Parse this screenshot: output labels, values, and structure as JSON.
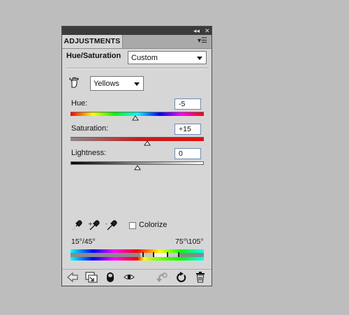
{
  "panel": {
    "tab_label": "ADJUSTMENTS",
    "window_controls": "◂◂ ✕",
    "adjustment_title": "Hue/Saturation",
    "preset": {
      "selected": "Custom"
    },
    "channel": {
      "selected": "Yellows"
    }
  },
  "sliders": {
    "hue": {
      "label": "Hue:",
      "value": "-5",
      "value_num": -5,
      "min": -180,
      "max": 180
    },
    "saturation": {
      "label": "Saturation:",
      "value": "+15",
      "value_num": 15,
      "min": -100,
      "max": 100
    },
    "lightness": {
      "label": "Lightness:",
      "value": "0",
      "value_num": 0,
      "min": -100,
      "max": 100
    }
  },
  "colorize": {
    "label": "Colorize",
    "checked": false
  },
  "range": {
    "left": "15°/45°",
    "right": "75°\\105°"
  },
  "icons": {
    "targeted_adjustment": "hand-adjust-icon",
    "eyedroppers": [
      "eyedropper-icon",
      "eyedropper-add-icon",
      "eyedropper-subtract-icon"
    ],
    "bottom": [
      "back-arrow-icon",
      "clip-to-layer-icon",
      "toggle-layer-icon",
      "visibility-eye-icon",
      "previous-state-icon",
      "reset-icon",
      "delete-icon"
    ]
  },
  "colors": {
    "panel_bg": "#d6d6d6",
    "tab_bg": "#a9a9a9",
    "field_border": "#6d8bb0"
  }
}
